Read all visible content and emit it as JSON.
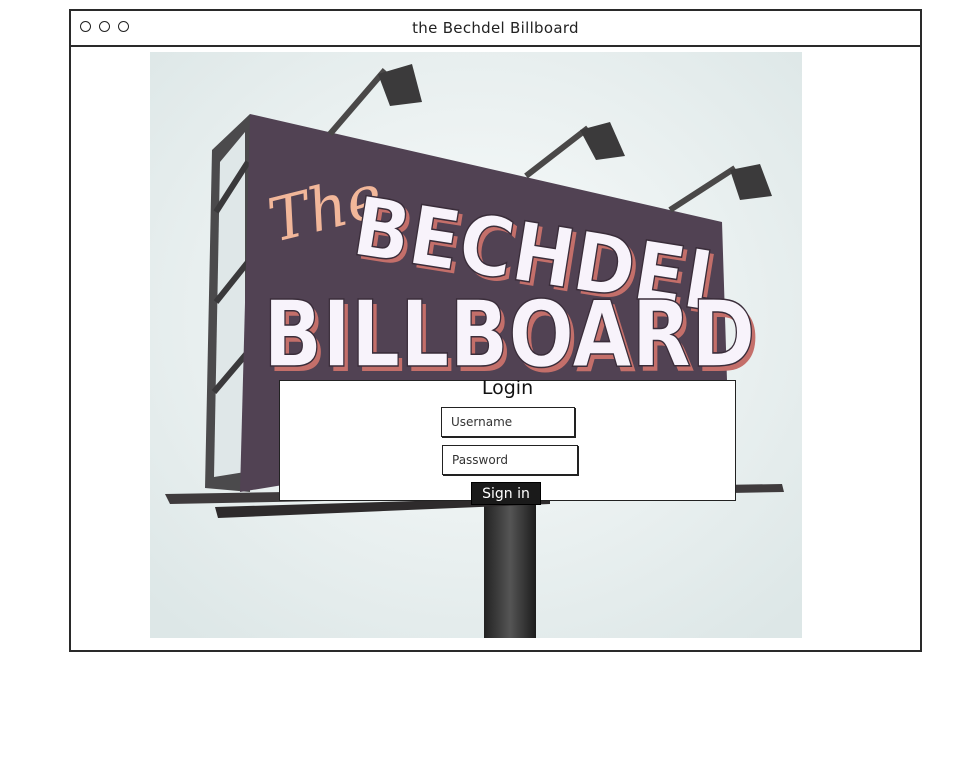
{
  "window": {
    "title": "the Bechdel Billboard"
  },
  "billboard": {
    "line1": "The",
    "line2": "BECHDEL",
    "line3": "BILLBOARD",
    "colors": {
      "board": "#514253",
      "script": "#f2b79a",
      "block": "#f8f3fb",
      "shadow": "#c46f6a",
      "background": "#e8efef"
    }
  },
  "login": {
    "title": "Login",
    "username_placeholder": "Username",
    "password_placeholder": "Password",
    "signin_label": "Sign in"
  }
}
